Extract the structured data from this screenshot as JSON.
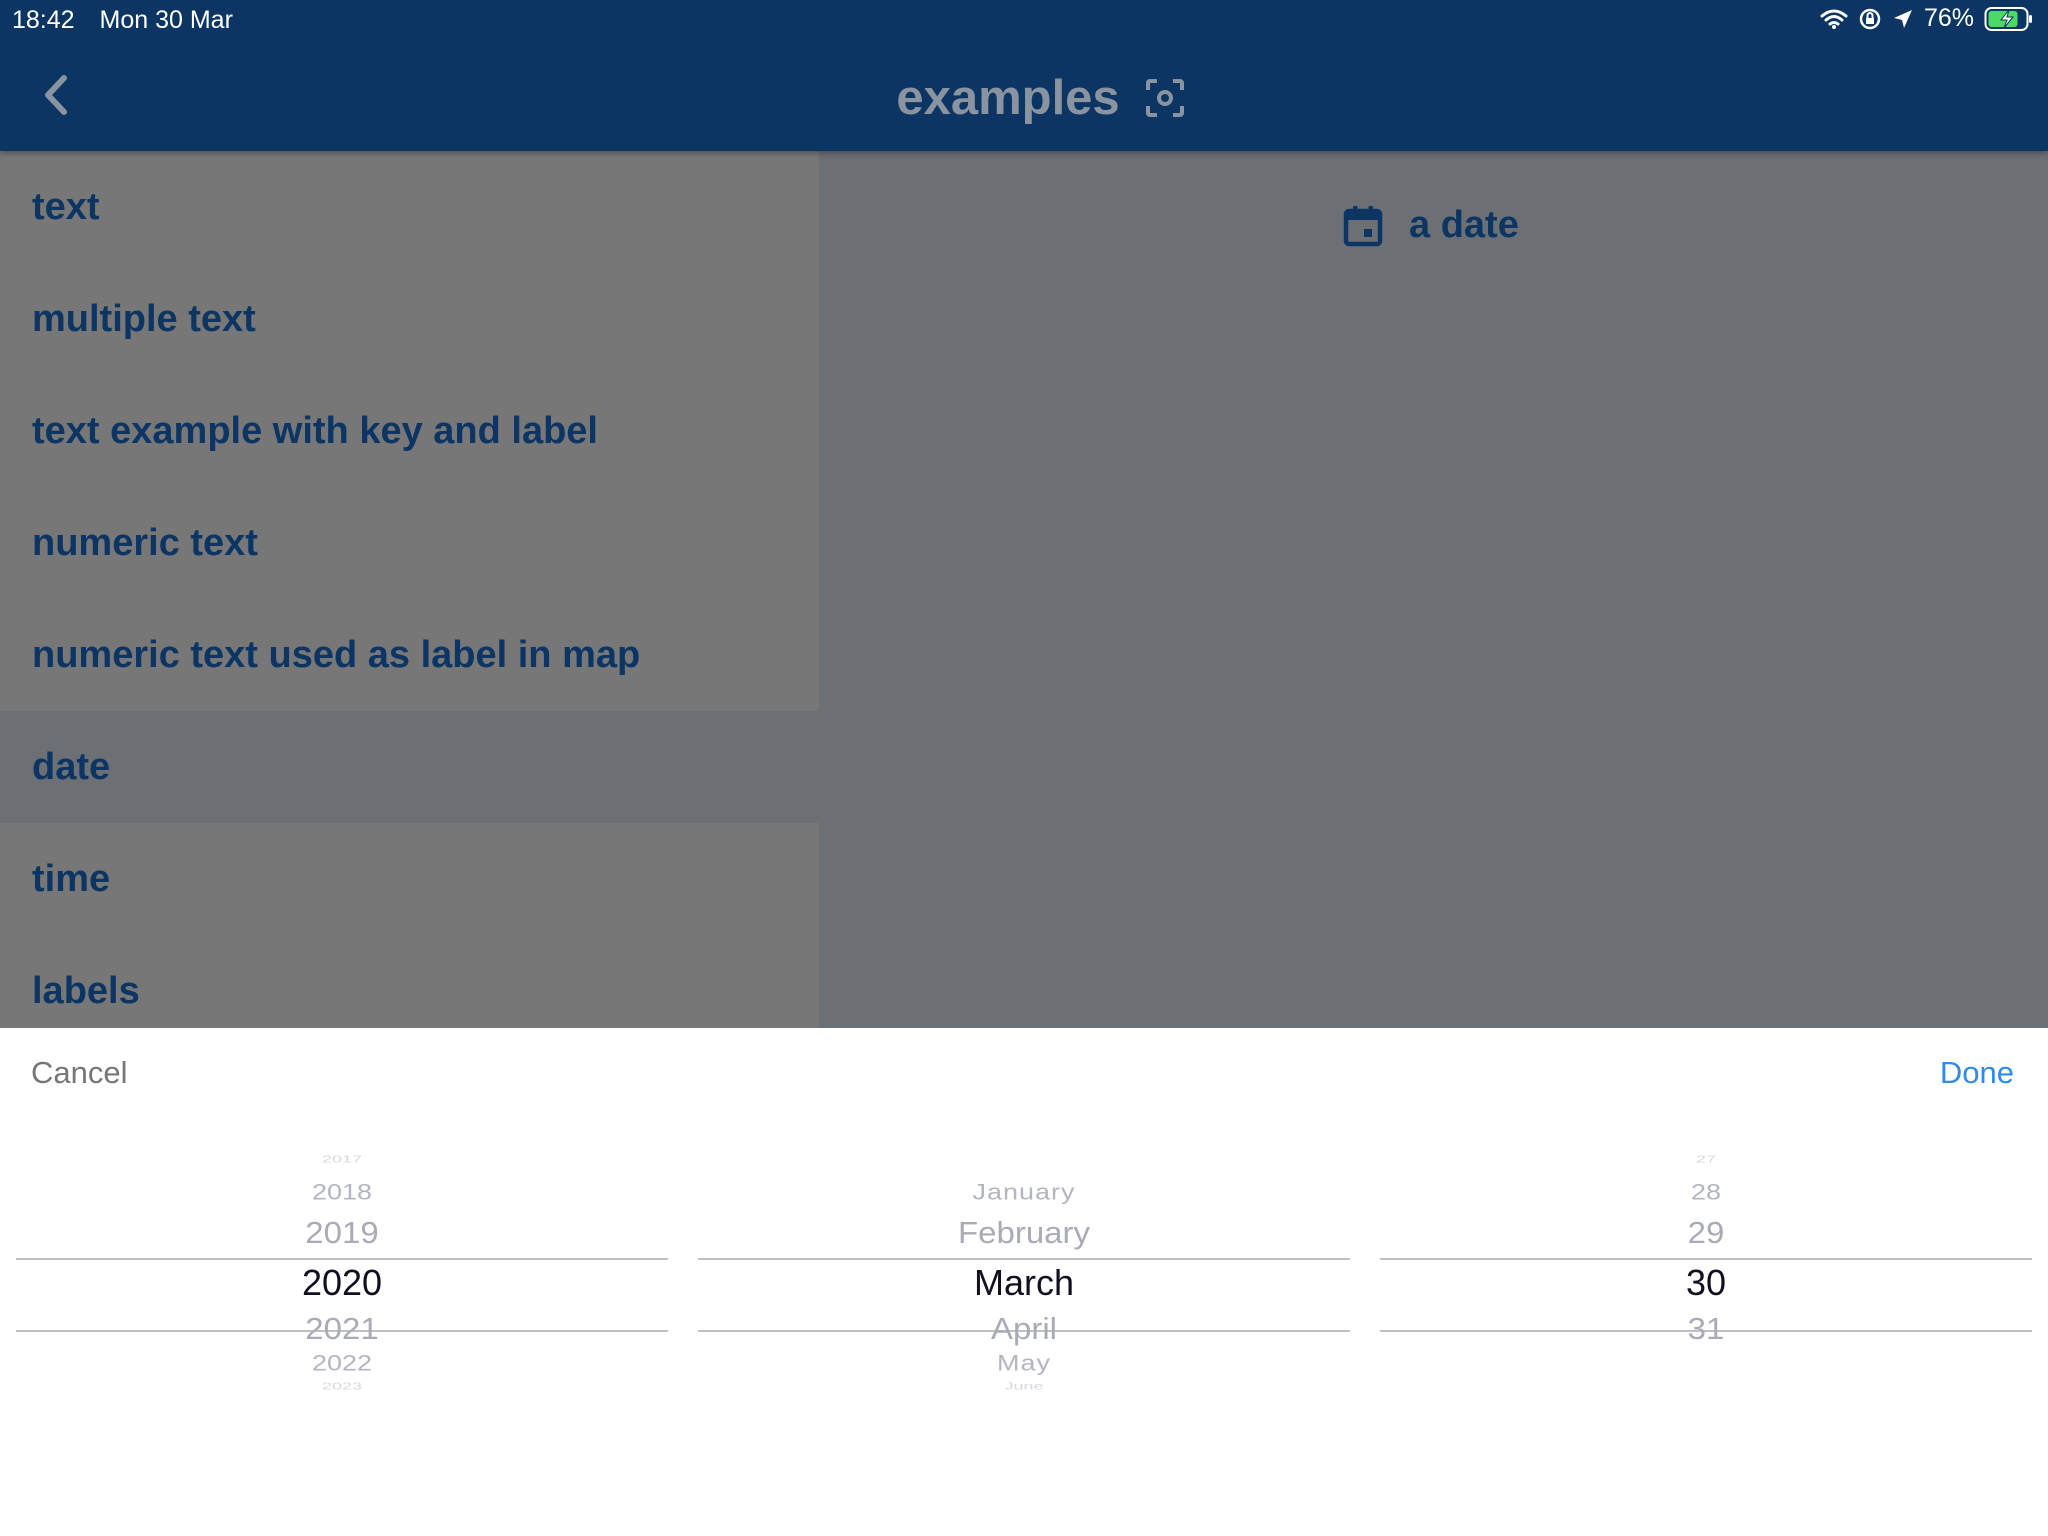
{
  "status_bar": {
    "time": "18:42",
    "date": "Mon 30 Mar",
    "battery": "76%",
    "icons": [
      "wifi-icon",
      "screen-lock-icon",
      "location-arrow-icon",
      "battery-charging-icon"
    ]
  },
  "nav": {
    "title": "examples",
    "back_icon": "chevron-left-icon",
    "scan_icon": "focus-scan-icon"
  },
  "sidebar": {
    "items": [
      {
        "label": "text"
      },
      {
        "label": "multiple text"
      },
      {
        "label": "text example with key and label"
      },
      {
        "label": "numeric text"
      },
      {
        "label": "numeric text used as label in map"
      },
      {
        "label": "date",
        "selected": true
      },
      {
        "label": "time"
      },
      {
        "label": "labels"
      }
    ]
  },
  "detail": {
    "date_field": {
      "label": "a date",
      "icon": "calendar-icon"
    }
  },
  "picker": {
    "cancel_label": "Cancel",
    "done_label": "Done",
    "year": {
      "items": [
        "2017",
        "2018",
        "2019",
        "2020",
        "2021",
        "2022",
        "2023"
      ],
      "selected": "2020"
    },
    "month": {
      "items": [
        "",
        "January",
        "February",
        "March",
        "April",
        "May",
        "June"
      ],
      "selected": "March"
    },
    "day": {
      "items": [
        "27",
        "28",
        "29",
        "30",
        "31",
        "",
        ""
      ],
      "selected": "30"
    }
  },
  "colors": {
    "nav_bg": "#0c3563",
    "accent_text": "#0c3563",
    "done_blue": "#2e8be6",
    "overlay_sidebar": "#777777",
    "overlay_detail": "#6c7074"
  }
}
